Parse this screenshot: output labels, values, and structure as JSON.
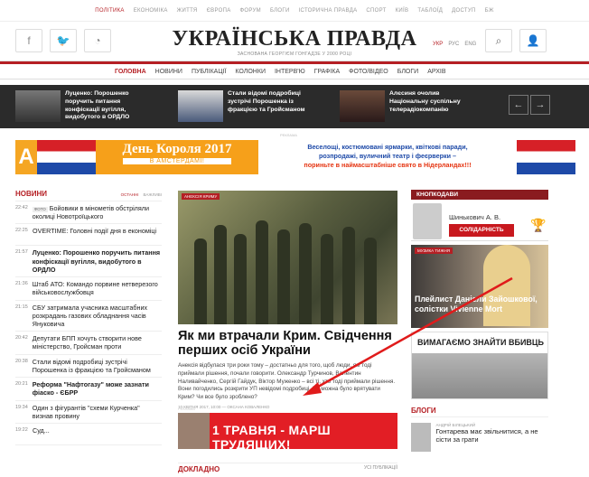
{
  "topnav": [
    "ПОЛІТИКА",
    "ЕКОНОМІКА",
    "ЖИТТЯ",
    "ЄВРОПА",
    "ФОРУМ",
    "БЛОГИ",
    "ІСТОРИЧНА ПРАВДА",
    "СПОРТ",
    "КИЇВ",
    "ТАБЛОЇД",
    "ДОСТУП",
    "БЖ"
  ],
  "logo": {
    "title": "УКРАЇНСЬКА ПРАВДА",
    "subtitle": "ЗАСНОВАНА ГЕОРГІЄМ ГОНГАДЗЕ У 2000 РОЦІ"
  },
  "langs": [
    "УКР",
    "РУС",
    "ENG"
  ],
  "mainnav": [
    "ГОЛОВНА",
    "НОВИНИ",
    "ПУБЛІКАЦІЇ",
    "КОЛОНКИ",
    "ІНТЕРВ'Ю",
    "ГРАФІКА",
    "ФОТО/ВІДЕО",
    "БЛОГИ",
    "АРХІВ"
  ],
  "top_stories": [
    "Луценко: Порошенко поручить питання конфіскації вугілля, видобутого в ОРДЛО",
    "Стали відомі подробиці зустрічі Порошенка із фракцією та Гройсманом",
    "Алєсиня очолив Національну суспільну телерадіокомпанію"
  ],
  "banner": {
    "letter": "А",
    "title": "День Короля 2017",
    "subtitle": "В АМСТЕРДАМІ!",
    "line1": "Веселощі, костюмовані ярмарки, квіткові паради,",
    "line2": "розпродажі, вуличний театр і феєрверки –",
    "line3": "пориньте в наймасштабніше свято в Нідерландах!!!",
    "label": "РЕКЛАМА"
  },
  "news": {
    "title": "НОВИНИ",
    "tab_latest": "ОСТАННІ",
    "tab_important": "ВАЖЛИВІ",
    "items": [
      {
        "time": "22:42",
        "badge": "ФОТО",
        "text": "Бойовики в мінометів обстріляли околиці Новотроїцького"
      },
      {
        "time": "22:25",
        "badge": "",
        "text": "OVERTIME: Головні події дня в економіці"
      },
      {
        "time": "21:57",
        "badge": "",
        "text": "Луценко: Порошенко поручить питання конфіскації вугілля, видобутого в ОРДЛО"
      },
      {
        "time": "21:36",
        "badge": "",
        "text": "Штаб АТО: Командо порвине нетверезого військовослужбовця"
      },
      {
        "time": "21:15",
        "badge": "",
        "text": "СБУ затримала учасника масштабних розкрадань газових обладнання часів Януковича"
      },
      {
        "time": "20:42",
        "badge": "",
        "text": "Депутати БПП хочуть створити нове міністерство, Гройсман проти"
      },
      {
        "time": "20:38",
        "badge": "",
        "text": "Стали відомі подробиці зустрічі Порошенка із фракцією та Гройсманом"
      },
      {
        "time": "20:21",
        "badge": "",
        "text": "Реформа \"Нафтогазу\" може зазнати фіаско - ЄБРР"
      },
      {
        "time": "19:34",
        "badge": "",
        "text": "Один з фігурантів \"схеми Курченка\" визнав провину"
      },
      {
        "time": "19:22",
        "badge": "",
        "text": "Суд..."
      }
    ]
  },
  "center": {
    "tag": "АНЕКСІЯ КРИМУ",
    "title": "Як ми втрачали Крим. Свідчення перших осіб України",
    "text": "Анексія відбулася три роки тому – достатньо для того, щоб люди, які тоді приймали рішення, почали говорити. Олександр Турчинов, Валентин Наливайченко, Сергій Гайдук, Віктор Муженко – всі ті, хто тоді приймали рішення. Вони погодились розкрити УП невідомі подробиці. Чи можна було врятувати Крим? Чи все було зроблено?",
    "meta": "10 КВІТНЯ 2017, 10:00 — ОКСАНА КОВАЛЕНКО",
    "ad_text": "1 ТРАВНЯ - МАРШ ТРУДЯЩИХ!",
    "ad_label": "РЕКЛАМА",
    "doklad": "ДОКЛАДНО",
    "all_pubs": "УСІ ПУБЛІКАЦІЇ"
  },
  "right": {
    "header": "КНОПКОДАВИ",
    "person": "Шинькович А. В.",
    "party": "СОЛІДАРНІСТЬ",
    "music_tag": "МУЗИКА ТИЖНЯ",
    "music_title": "Плейлист Даніели Зайошкової, солістки Vivienne Mort",
    "wanted": "ВИМАГАЄМО ЗНАЙТИ ВБИВЦЬ",
    "blogs_title": "БЛОГИ",
    "blog_author": "АНДРІЙ БІЛЕЦЬКИЙ",
    "blog_text": "Гонтарева має звільнитися, а не сісти за грати"
  },
  "colors": {
    "accent": "#b51f24",
    "dark_strip": "#2b2b2b",
    "ad_red": "#e21e25",
    "banner_orange": "#f6a01a"
  }
}
